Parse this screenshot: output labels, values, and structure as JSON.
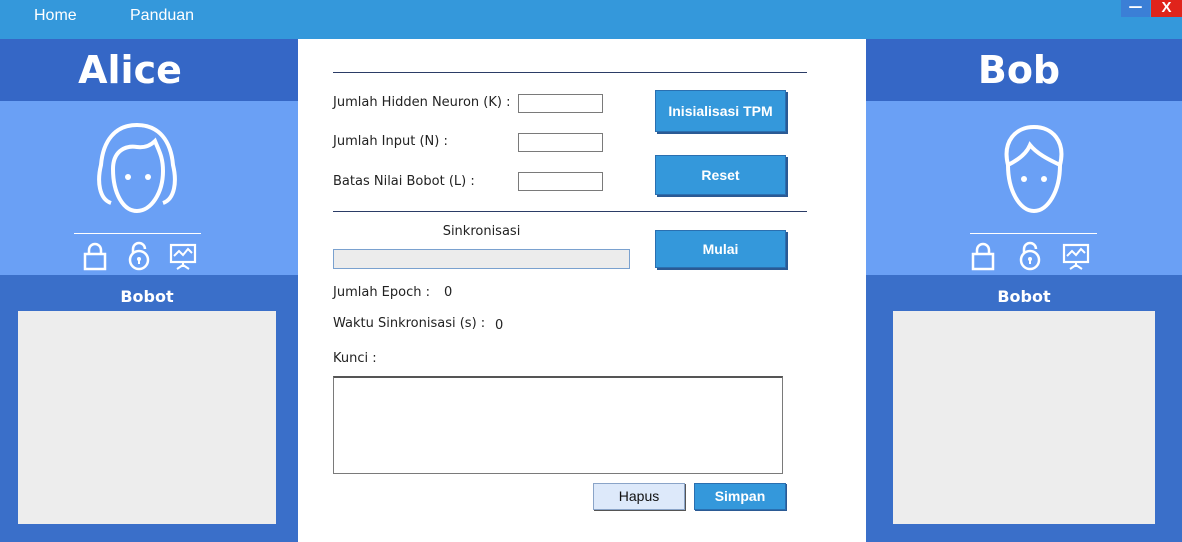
{
  "menu": {
    "home": "Home",
    "panduan": "Panduan",
    "minimize": "—",
    "close": "X"
  },
  "alice": {
    "name": "Alice",
    "bobot_label": "Bobot",
    "icons": [
      "lock-icon",
      "unlock-icon",
      "presentation-icon"
    ]
  },
  "bob": {
    "name": "Bob",
    "bobot_label": "Bobot",
    "icons": [
      "lock-icon",
      "unlock-icon",
      "presentation-icon"
    ]
  },
  "form": {
    "hidden_neuron_label": "Jumlah Hidden Neuron (K) :",
    "hidden_neuron_value": "",
    "input_label": "Jumlah Input (N) :",
    "input_value": "",
    "bobot_limit_label": "Batas Nilai Bobot (L) :",
    "bobot_limit_value": "",
    "init_button": "Inisialisasi TPM",
    "reset_button": "Reset",
    "sync_label": "Sinkronisasi",
    "sync_progress": 0,
    "start_button": "Mulai",
    "epoch_label": "Jumlah Epoch :",
    "epoch_value": "0",
    "sync_time_label": "Waktu Sinkronisasi (s)  :",
    "sync_time_value": "0",
    "key_label": "Kunci :",
    "key_value": "",
    "delete_button": "Hapus",
    "save_button": "Simpan"
  },
  "colors": {
    "menubar": "#3498db",
    "side_panel": "#3a6fc9",
    "side_title": "#3567c6",
    "avatar_area": "#6aa0f5",
    "accent_button": "#3498db",
    "close": "#e0241b"
  }
}
